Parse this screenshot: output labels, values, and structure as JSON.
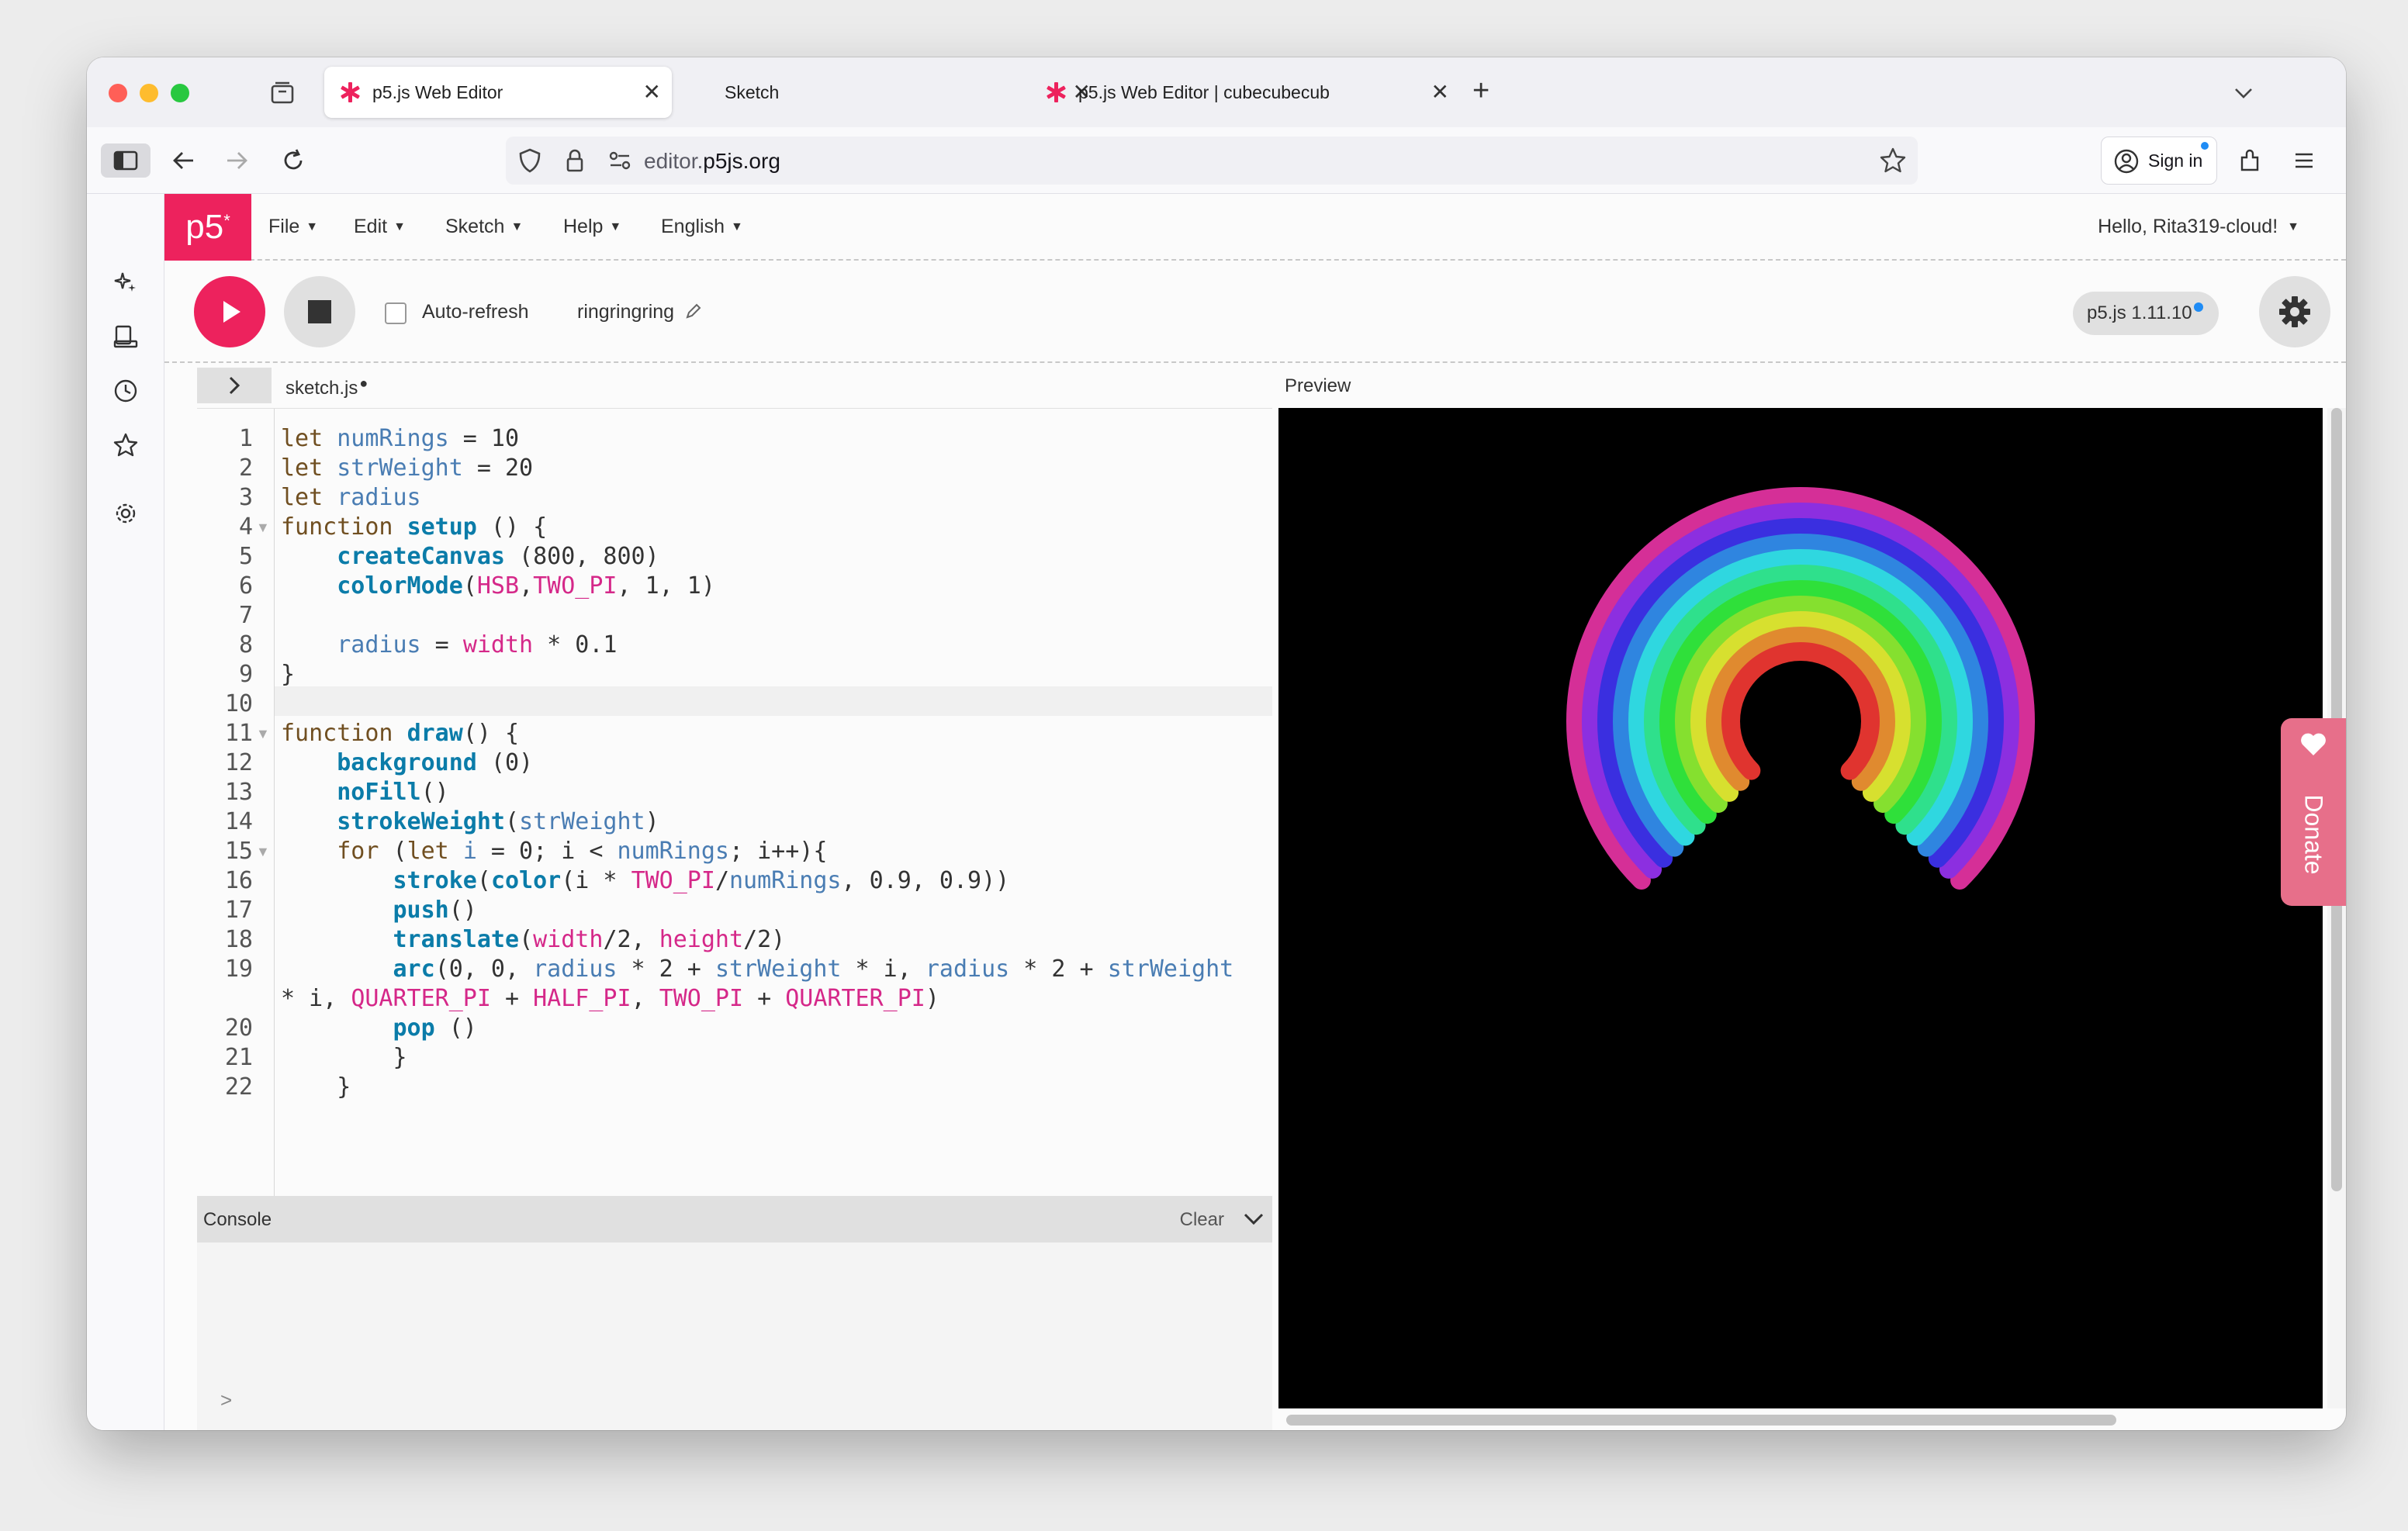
{
  "browser": {
    "tabs": [
      {
        "label": "p5.js Web Editor",
        "active": true
      },
      {
        "label": "Sketch",
        "active": false
      },
      {
        "label": "p5.js Web Editor | cubecubecub",
        "active": false
      }
    ],
    "new_tab": "+",
    "url_host_prefix": "editor.",
    "url_host_main": "p5js.org",
    "sign_in": "Sign in"
  },
  "app": {
    "logo": "p5",
    "logo_sup": "*",
    "menus": [
      "File",
      "Edit",
      "Sketch",
      "Help",
      "English"
    ],
    "greeting": "Hello, Rita319-cloud!",
    "auto_refresh": "Auto-refresh",
    "project_name": "ringringring",
    "version": "p5.js 1.11.10",
    "file_tab": "sketch.js",
    "preview_label": "Preview",
    "console_label": "Console",
    "console_clear": "Clear",
    "console_prompt": ">",
    "donate": "Donate"
  },
  "code_lines": [
    {
      "n": "1",
      "tokens": [
        [
          "k",
          "let "
        ],
        [
          "v",
          "numRings"
        ],
        [
          "n",
          " = 10"
        ]
      ]
    },
    {
      "n": "2",
      "tokens": [
        [
          "k",
          "let "
        ],
        [
          "v",
          "strWeight"
        ],
        [
          "n",
          " = 20"
        ]
      ]
    },
    {
      "n": "3",
      "tokens": [
        [
          "k",
          "let "
        ],
        [
          "v",
          "radius"
        ]
      ]
    },
    {
      "n": "4",
      "fold": true,
      "tokens": [
        [
          "k",
          "function "
        ],
        [
          "f",
          "setup"
        ],
        [
          "n",
          " () {"
        ]
      ]
    },
    {
      "n": "5",
      "tokens": [
        [
          "n",
          "    "
        ],
        [
          "f",
          "createCanvas"
        ],
        [
          "n",
          " (800, 800)"
        ]
      ]
    },
    {
      "n": "6",
      "tokens": [
        [
          "n",
          "    "
        ],
        [
          "f",
          "colorMode"
        ],
        [
          "n",
          "("
        ],
        [
          "cst",
          "HSB"
        ],
        [
          "n",
          ","
        ],
        [
          "cst",
          "TWO_PI"
        ],
        [
          "n",
          ", 1, 1)"
        ]
      ]
    },
    {
      "n": "7",
      "tokens": [
        [
          "n",
          ""
        ]
      ]
    },
    {
      "n": "8",
      "tokens": [
        [
          "n",
          "    "
        ],
        [
          "v",
          "radius"
        ],
        [
          "n",
          " = "
        ],
        [
          "cst",
          "width"
        ],
        [
          "n",
          " * 0.1"
        ]
      ]
    },
    {
      "n": "9",
      "tokens": [
        [
          "n",
          "}"
        ]
      ]
    },
    {
      "n": "10",
      "tokens": [
        [
          "n",
          ""
        ]
      ]
    },
    {
      "n": "11",
      "fold": true,
      "tokens": [
        [
          "k",
          "function "
        ],
        [
          "f",
          "draw"
        ],
        [
          "n",
          "() {"
        ]
      ]
    },
    {
      "n": "12",
      "tokens": [
        [
          "n",
          "    "
        ],
        [
          "f",
          "background"
        ],
        [
          "n",
          " (0)"
        ]
      ]
    },
    {
      "n": "13",
      "tokens": [
        [
          "n",
          "    "
        ],
        [
          "f",
          "noFill"
        ],
        [
          "n",
          "()"
        ]
      ]
    },
    {
      "n": "14",
      "tokens": [
        [
          "n",
          "    "
        ],
        [
          "f",
          "strokeWeight"
        ],
        [
          "n",
          "("
        ],
        [
          "v",
          "strWeight"
        ],
        [
          "n",
          ")"
        ]
      ]
    },
    {
      "n": "15",
      "fold": true,
      "tokens": [
        [
          "n",
          "    "
        ],
        [
          "k",
          "for"
        ],
        [
          "n",
          " ("
        ],
        [
          "k",
          "let "
        ],
        [
          "v",
          "i"
        ],
        [
          "n",
          " = 0; i < "
        ],
        [
          "v",
          "numRings"
        ],
        [
          "n",
          "; i++){"
        ]
      ]
    },
    {
      "n": "16",
      "tokens": [
        [
          "n",
          "        "
        ],
        [
          "f",
          "stroke"
        ],
        [
          "n",
          "("
        ],
        [
          "f",
          "color"
        ],
        [
          "n",
          "(i * "
        ],
        [
          "cst",
          "TWO_PI"
        ],
        [
          "n",
          "/"
        ],
        [
          "v",
          "numRings"
        ],
        [
          "n",
          ", 0.9, 0.9))"
        ]
      ]
    },
    {
      "n": "17",
      "tokens": [
        [
          "n",
          "        "
        ],
        [
          "f",
          "push"
        ],
        [
          "n",
          "()"
        ]
      ]
    },
    {
      "n": "18",
      "tokens": [
        [
          "n",
          "        "
        ],
        [
          "f",
          "translate"
        ],
        [
          "n",
          "("
        ],
        [
          "cst",
          "width"
        ],
        [
          "n",
          "/2, "
        ],
        [
          "cst",
          "height"
        ],
        [
          "n",
          "/2)"
        ]
      ]
    },
    {
      "n": "19",
      "tokens": [
        [
          "n",
          "        "
        ],
        [
          "f",
          "arc"
        ],
        [
          "n",
          "(0, 0, "
        ],
        [
          "v",
          "radius"
        ],
        [
          "n",
          " * 2 + "
        ],
        [
          "v",
          "strWeight"
        ],
        [
          "n",
          " * i, "
        ],
        [
          "v",
          "radius"
        ],
        [
          "n",
          " * 2 + "
        ],
        [
          "v",
          "strWeight"
        ]
      ]
    },
    {
      "n": "",
      "tokens": [
        [
          "n",
          "* i, "
        ],
        [
          "cst",
          "QUARTER_PI"
        ],
        [
          "n",
          " + "
        ],
        [
          "cst",
          "HALF_PI"
        ],
        [
          "n",
          ", "
        ],
        [
          "cst",
          "TWO_PI"
        ],
        [
          "n",
          " + "
        ],
        [
          "cst",
          "QUARTER_PI"
        ],
        [
          "n",
          ")"
        ]
      ]
    },
    {
      "n": "20",
      "tokens": [
        [
          "n",
          "        "
        ],
        [
          "f",
          "pop"
        ],
        [
          "n",
          " ()"
        ]
      ]
    },
    {
      "n": "21",
      "tokens": [
        [
          "n",
          "        }"
        ]
      ]
    },
    {
      "n": "22",
      "tokens": [
        [
          "n",
          "    }"
        ]
      ]
    }
  ],
  "colors": {
    "brand": "#ed225d",
    "rings": [
      "#e0342f",
      "#e08a2f",
      "#d7e02f",
      "#85e02f",
      "#2fe03a",
      "#2fe08c",
      "#2fd7e0",
      "#2f85e0",
      "#3a2fe0",
      "#8c2fe0",
      "#d52f97"
    ]
  }
}
